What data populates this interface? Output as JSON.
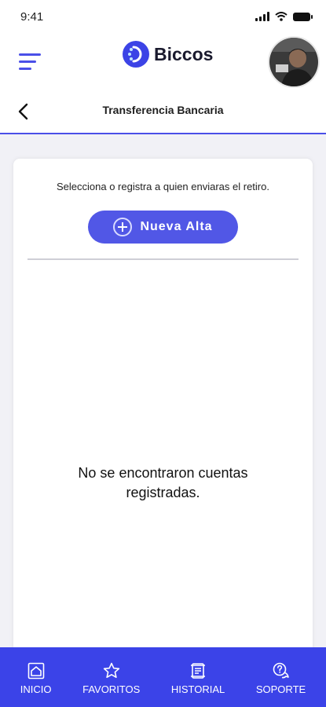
{
  "status_bar": {
    "time": "9:41"
  },
  "header": {
    "app_name": "Biccos"
  },
  "subheader": {
    "title": "Transferencia Bancaria"
  },
  "card": {
    "instruction": "Selecciona o registra a quien enviaras el retiro.",
    "new_button_label": "Nueva Alta",
    "empty_message": "No se encontraron cuentas registradas."
  },
  "bottom_nav": {
    "items": [
      {
        "label": "INICIO",
        "icon": "home-icon"
      },
      {
        "label": "FAVORITOS",
        "icon": "star-icon"
      },
      {
        "label": "HISTORIAL",
        "icon": "scroll-icon"
      },
      {
        "label": "SOPORTE",
        "icon": "support-icon"
      }
    ]
  },
  "colors": {
    "accent": "#4a4fe8",
    "button": "#5157e6",
    "nav_background": "#3b43e8"
  }
}
